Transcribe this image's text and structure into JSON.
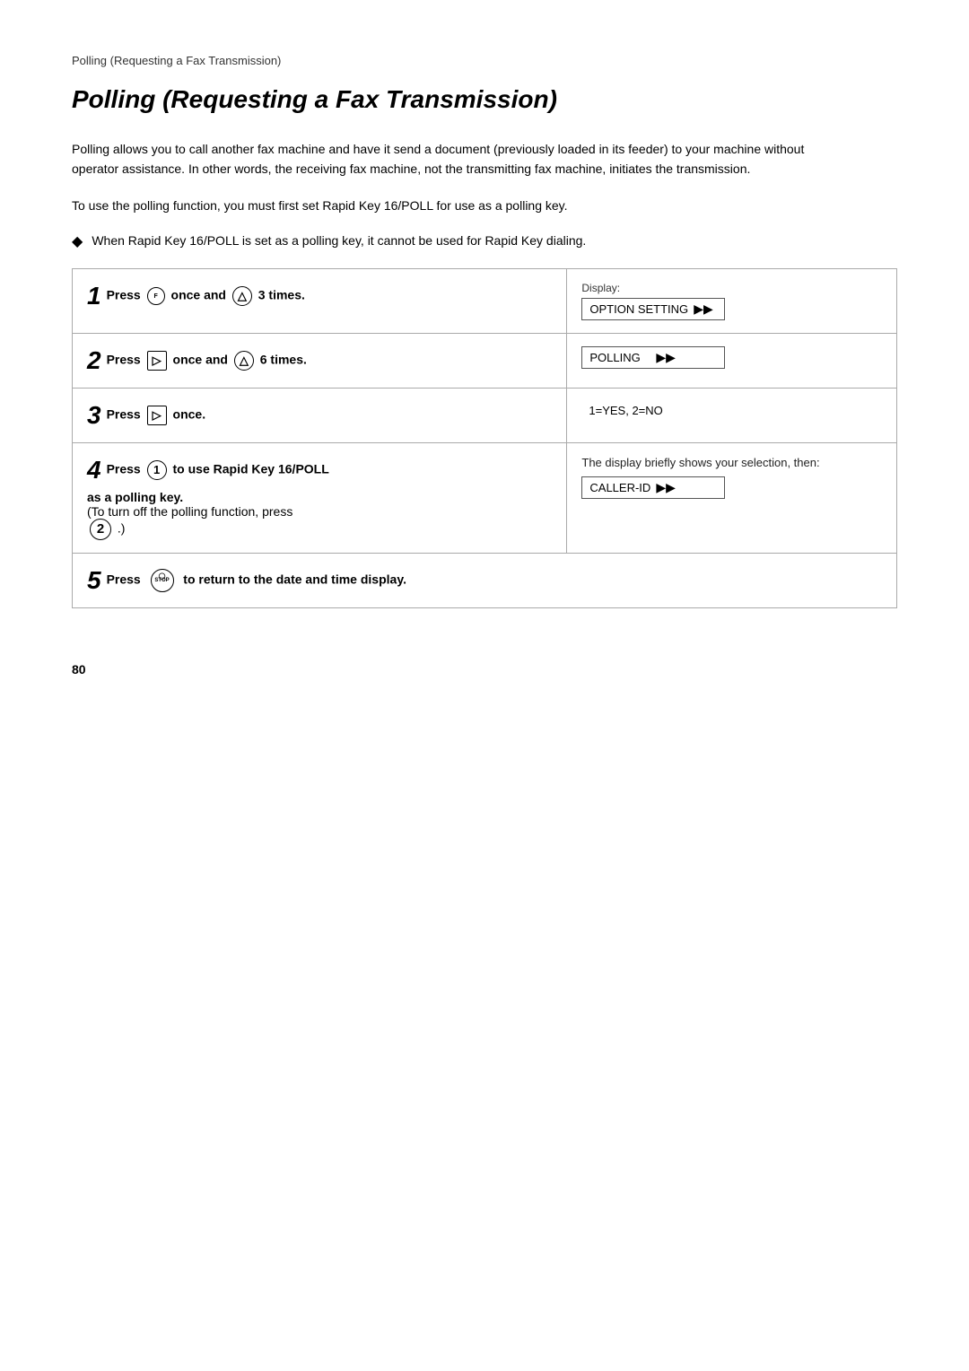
{
  "breadcrumb": "Polling (Requesting a Fax Transmission)",
  "page_title": "Polling (Requesting a Fax Transmission)",
  "intro_paragraphs": [
    "Polling allows you to call another fax machine and have it send a document (previously loaded in its feeder) to your machine without operator assistance. In other words, the receiving fax machine, not the transmitting fax machine, initiates the transmission.",
    "To use the polling function, you must first set Rapid Key 16/POLL for use as a polling key."
  ],
  "note": {
    "symbol": "◆",
    "text": "When Rapid Key 16/POLL is set as a polling key, it cannot be used for Rapid Key dialing."
  },
  "display_label": "Display:",
  "steps": [
    {
      "number": "1",
      "instruction_parts": [
        {
          "type": "text",
          "content": "Press "
        },
        {
          "type": "icon",
          "name": "function-icon",
          "label": "FUNCTION"
        },
        {
          "type": "text",
          "content": " once and "
        },
        {
          "type": "icon",
          "name": "scroll-up-icon",
          "label": "▲"
        },
        {
          "type": "text",
          "content": " 3 times."
        }
      ],
      "display_text": "OPTION SETTING",
      "display_arrow": "▶▶"
    },
    {
      "number": "2",
      "instruction_parts": [
        {
          "type": "text",
          "content": "Press "
        },
        {
          "type": "icon",
          "name": "menu-right-icon",
          "label": "▶"
        },
        {
          "type": "text",
          "content": " once and "
        },
        {
          "type": "icon",
          "name": "scroll-up2-icon",
          "label": "▲"
        },
        {
          "type": "text",
          "content": " 6 times."
        }
      ],
      "display_text": "POLLING",
      "display_arrow": "▶▶"
    },
    {
      "number": "3",
      "instruction_parts": [
        {
          "type": "text",
          "content": "Press "
        },
        {
          "type": "icon",
          "name": "menu-right2-icon",
          "label": "▶"
        },
        {
          "type": "text",
          "content": " once."
        }
      ],
      "display_text": "1=YES, 2=NO",
      "display_arrow": ""
    },
    {
      "number": "4",
      "instruction_parts": [
        {
          "type": "text",
          "content": "Press "
        },
        {
          "type": "icon",
          "name": "key1-icon",
          "label": "1"
        },
        {
          "type": "text",
          "content": " to use Rapid Key 16/POLL"
        }
      ],
      "sub_bold": "as a polling key.",
      "sub_paren": "(To turn off the polling function, press",
      "sub_paren2_icon": "2",
      "sub_paren2_end": ".)",
      "display_note": "The display briefly shows your selection, then:",
      "display_text": "CALLER-ID",
      "display_arrow": "▶▶"
    },
    {
      "number": "5",
      "instruction_parts": [
        {
          "type": "text",
          "content": "Press "
        },
        {
          "type": "icon",
          "name": "stop-icon",
          "label": "STOP"
        },
        {
          "type": "text",
          "content": " to return to the date and time display."
        }
      ],
      "display_text": "",
      "display_arrow": ""
    }
  ],
  "page_number": "80"
}
